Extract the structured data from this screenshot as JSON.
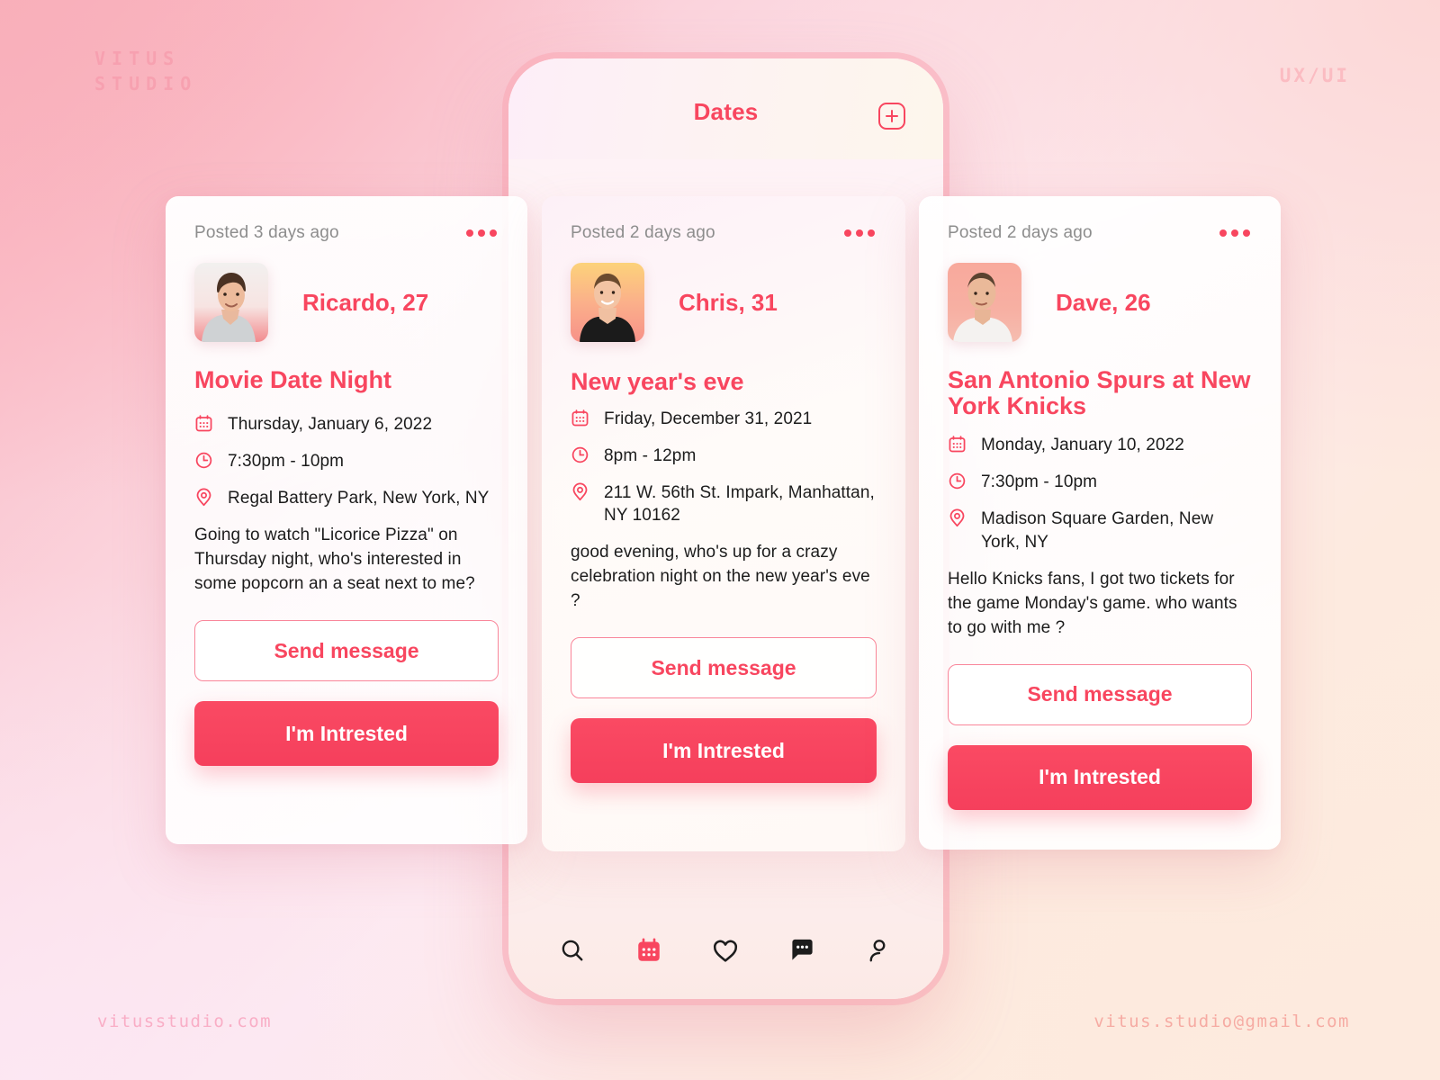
{
  "branding": {
    "studio_line1": "VITUS",
    "studio_line2": "STUDIO",
    "tag": "UX/UI",
    "website": "vitusstudio.com",
    "email": "vitus.studio@gmail.com"
  },
  "phone": {
    "header": {
      "title": "Dates",
      "add_icon": "plus-square-icon"
    },
    "nav": [
      {
        "name": "search",
        "icon": "search-icon",
        "active": false
      },
      {
        "name": "dates",
        "icon": "calendar-icon",
        "active": true
      },
      {
        "name": "likes",
        "icon": "heart-icon",
        "active": false
      },
      {
        "name": "messages",
        "icon": "chat-icon",
        "active": false
      },
      {
        "name": "profile",
        "icon": "person-icon",
        "active": false
      }
    ]
  },
  "colors": {
    "accent": "#f8465f",
    "accent_soft": "#f9869a",
    "muted_text": "#8d8d8d",
    "body_text": "#1c1c1c"
  },
  "cards": [
    {
      "posted": "Posted 3 days ago",
      "menu_icon": "more-horizontal-icon",
      "avatar": "photo-ricardo",
      "person": "Ricardo, 27",
      "title": "Movie Date Night",
      "date": "Thursday, January 6, 2022",
      "time": "7:30pm - 10pm",
      "location": "Regal Battery Park, New York, NY",
      "description": "Going to watch \"Licorice Pizza\" on Thursday night, who's interested in some popcorn an a seat next to me?",
      "btn_secondary": "Send message",
      "btn_primary": "I'm Intrested"
    },
    {
      "posted": "Posted 2 days ago",
      "menu_icon": "more-horizontal-icon",
      "avatar": "photo-chris",
      "person": "Chris, 31",
      "title": "New year's eve",
      "date": "Friday, December 31, 2021",
      "time": "8pm - 12pm",
      "location": "211 W. 56th St. Impark, Manhattan, NY 10162",
      "description": "good evening, who's up for a crazy celebration night on the new year's eve ?",
      "btn_secondary": "Send message",
      "btn_primary": "I'm Intrested"
    },
    {
      "posted": "Posted 2 days ago",
      "menu_icon": "more-horizontal-icon",
      "avatar": "photo-dave",
      "person": "Dave, 26",
      "title": "San Antonio Spurs at New York Knicks",
      "date": "Monday, January 10, 2022",
      "time": "7:30pm - 10pm",
      "location": "Madison Square Garden, New York, NY",
      "description": "Hello Knicks fans, I got two tickets for the game Monday's game. who wants to go with me ?",
      "btn_secondary": "Send message",
      "btn_primary": "I'm Intrested"
    }
  ]
}
